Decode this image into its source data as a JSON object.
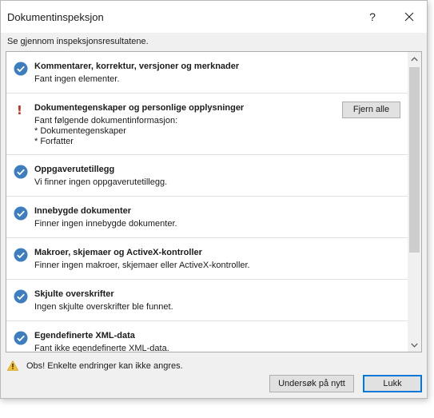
{
  "window": {
    "title": "Dokumentinspeksjon",
    "help_label": "?"
  },
  "subtitle": "Se gjennom inspeksjonsresultatene.",
  "colors": {
    "check_blue": "#3d7ebf",
    "warning_red": "#c42b1c",
    "footer_warning_yellow": "#f2c12e"
  },
  "results": [
    {
      "status": "ok",
      "status_icon": "checkmark-circle-icon",
      "heading": "Kommentarer, korrektur, versjoner og merknader",
      "detail": "Fant ingen elementer."
    },
    {
      "status": "issue",
      "status_icon": "exclamation-icon",
      "status_glyph": "!",
      "heading": "Dokumentegenskaper og personlige opplysninger",
      "detail": "Fant følgende dokumentinformasjon:\n* Dokumentegenskaper\n* Forfatter",
      "action_label": "Fjern alle"
    },
    {
      "status": "ok",
      "status_icon": "checkmark-circle-icon",
      "heading": "Oppgaverutetillegg",
      "detail": "Vi finner ingen oppgaverutetillegg."
    },
    {
      "status": "ok",
      "status_icon": "checkmark-circle-icon",
      "heading": "Innebygde dokumenter",
      "detail": "Finner ingen innebygde dokumenter."
    },
    {
      "status": "ok",
      "status_icon": "checkmark-circle-icon",
      "heading": "Makroer, skjemaer og ActiveX-kontroller",
      "detail": "Finner ingen makroer, skjemaer eller ActiveX-kontroller."
    },
    {
      "status": "ok",
      "status_icon": "checkmark-circle-icon",
      "heading": "Skjulte overskrifter",
      "detail": "Ingen skjulte overskrifter ble funnet."
    },
    {
      "status": "ok",
      "status_icon": "checkmark-circle-icon",
      "heading": "Egendefinerte XML-data",
      "detail": "Fant ikke egendefinerte XML-data."
    }
  ],
  "footer": {
    "warning_text": "Obs!  Enkelte endringer kan ikke angres.",
    "inspect_again_label": "Undersøk på nytt",
    "close_label": "Lukk"
  }
}
